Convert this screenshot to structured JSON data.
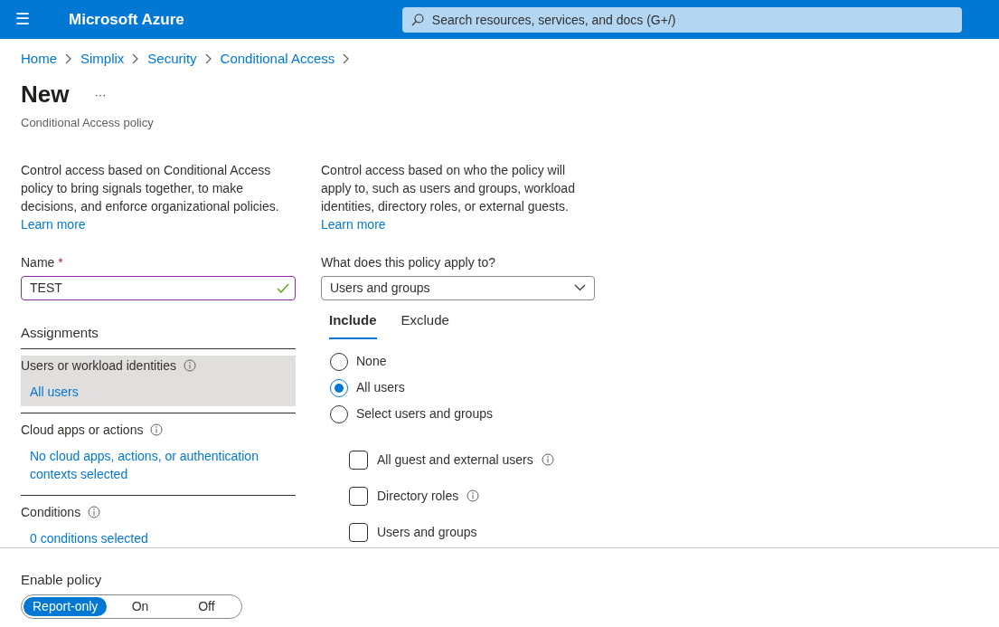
{
  "header": {
    "menu_glyph": "☰",
    "brand": "Microsoft Azure",
    "search_placeholder": "Search resources, services, and docs (G+/)"
  },
  "breadcrumb": [
    "Home",
    "Simplix",
    "Security",
    "Conditional Access"
  ],
  "page": {
    "title": "New",
    "more": "···",
    "subtitle": "Conditional Access policy"
  },
  "left": {
    "description": "Control access based on Conditional Access policy to bring signals together, to make decisions, and enforce organizational policies.",
    "learn_more": "Learn more",
    "name_label": "Name",
    "required_mark": "*",
    "name_value": "TEST",
    "name_valid": true,
    "assignments_heading": "Assignments",
    "assignments": [
      {
        "label": "Users or workload identities",
        "value": "All users",
        "selected": true
      },
      {
        "label": "Cloud apps or actions",
        "value": "No cloud apps, actions, or authentication contexts selected",
        "selected": false
      },
      {
        "label": "Conditions",
        "value": "0 conditions selected",
        "selected": false
      }
    ]
  },
  "right": {
    "description": "Control access based on who the policy will apply to, such as users and groups, workload identities, directory roles, or external guests.",
    "learn_more": "Learn more",
    "apply_label": "What does this policy apply to?",
    "apply_value": "Users and groups",
    "tabs": [
      {
        "label": "Include",
        "selected": true
      },
      {
        "label": "Exclude",
        "selected": false
      }
    ],
    "radios": [
      {
        "label": "None",
        "selected": false
      },
      {
        "label": "All users",
        "selected": true
      },
      {
        "label": "Select users and groups",
        "selected": false
      }
    ],
    "checkboxes": [
      {
        "label": "All guest and external users",
        "checked": false,
        "info": true
      },
      {
        "label": "Directory roles",
        "checked": false,
        "info": true
      },
      {
        "label": "Users and groups",
        "checked": false,
        "info": false
      }
    ]
  },
  "enable_policy": {
    "label": "Enable policy",
    "options": [
      {
        "label": "Report-only",
        "selected": true
      },
      {
        "label": "On",
        "selected": false
      },
      {
        "label": "Off",
        "selected": false
      }
    ]
  }
}
